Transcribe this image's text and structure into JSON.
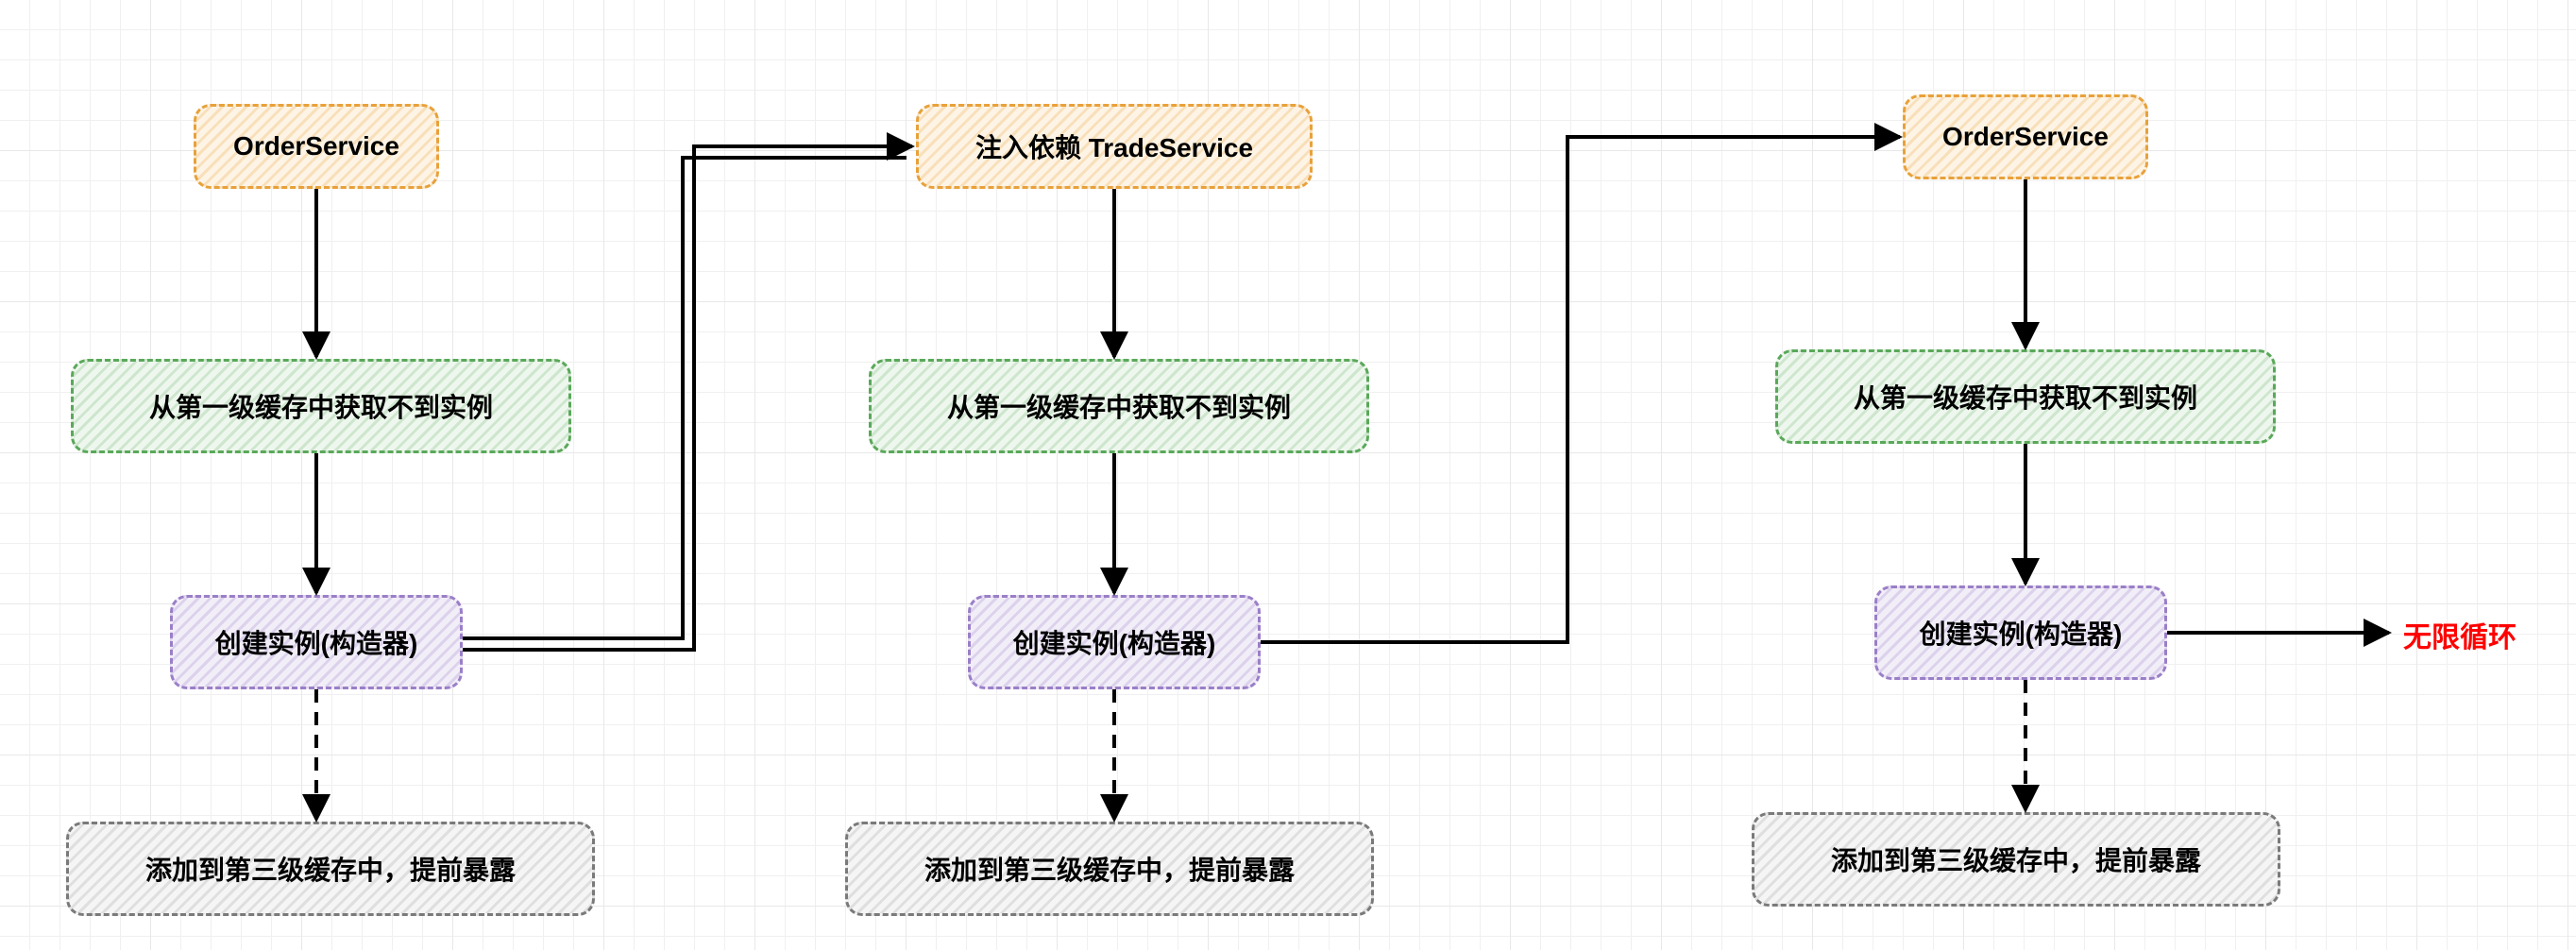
{
  "columns": [
    {
      "head": "OrderService",
      "cache": "从第一级缓存中获取不到实例",
      "ctor": "创建实例(构造器)",
      "expose": "添加到第三级缓存中，提前暴露"
    },
    {
      "head": "注入依赖 TradeService",
      "cache": "从第一级缓存中获取不到实例",
      "ctor": "创建实例(构造器)",
      "expose": "添加到第三级缓存中，提前暴露"
    },
    {
      "head": "OrderService",
      "cache": "从第一级缓存中获取不到实例",
      "ctor": "创建实例(构造器)",
      "expose": "添加到第三级缓存中，提前暴露"
    }
  ],
  "loop_label": "无限循环"
}
